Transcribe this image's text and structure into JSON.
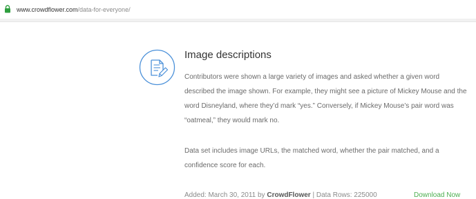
{
  "browser": {
    "url_host": "www.crowdflower.com",
    "url_path": "/data-for-everyone/"
  },
  "dataset": {
    "title": "Image descriptions",
    "description": "Contributors were shown a large variety of images and asked whether a given word described the image shown. For example, they might see a picture of Mickey Mouse and the word Disneyland, where they’d mark “yes.” Conversely, if Mickey Mouse’s pair word was “oatmeal,” they would mark no.",
    "contents": "Data set includes image URLs, the matched word, whether the pair matched, and a confidence score for each.",
    "added_label": "Added: March 30, 2011 by",
    "author": "CrowdFlower",
    "rows_label": "| Data Rows: 225000",
    "download_label": "Download Now"
  },
  "colors": {
    "accent_blue": "#4a90d9",
    "download_green": "#4caf50",
    "lock_green": "#2e9e3e"
  },
  "icons": {
    "secure": "lock-icon",
    "dataset": "document-edit-icon"
  }
}
